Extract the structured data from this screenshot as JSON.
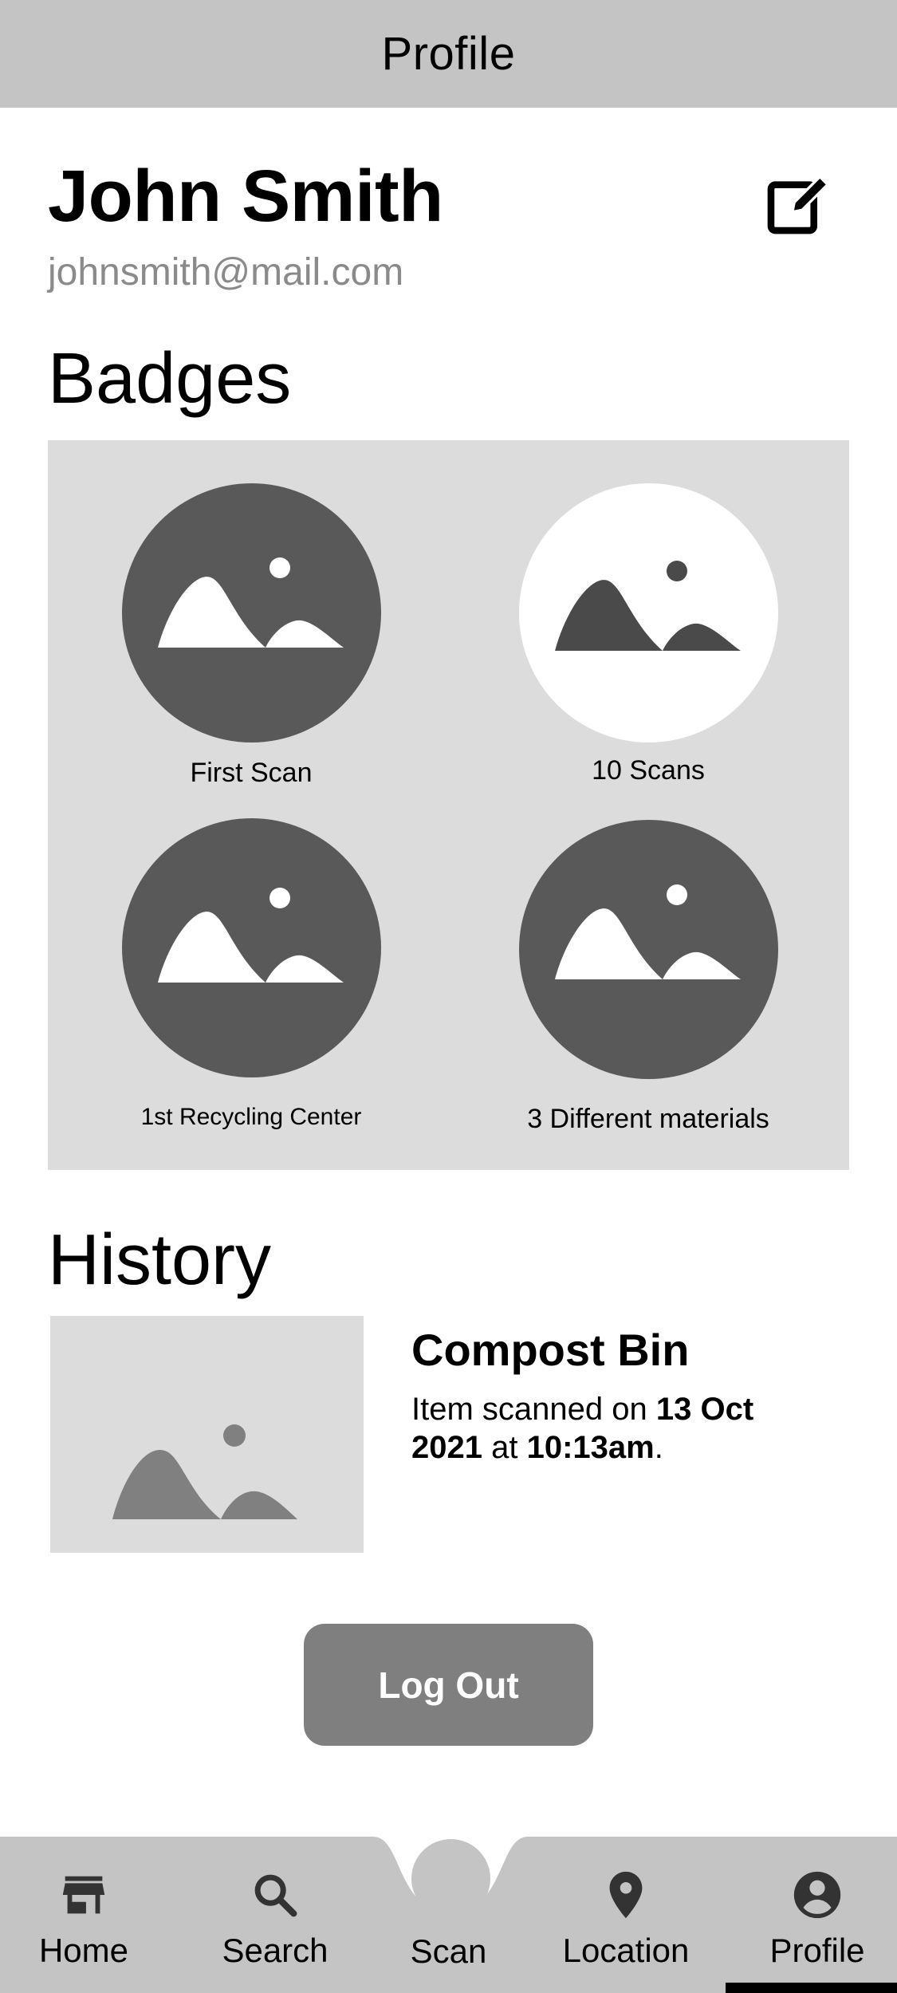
{
  "header": {
    "title": "Profile"
  },
  "user": {
    "name": "John Smith",
    "email": "johnsmith@mail.com",
    "edit_icon": "edit-icon"
  },
  "badges": {
    "title": "Badges",
    "items": [
      {
        "label": "First Scan",
        "earned": true
      },
      {
        "label": "10 Scans",
        "earned": false
      },
      {
        "label": "1st Recycling Center",
        "earned": true
      },
      {
        "label": "3 Different materials",
        "earned": true
      }
    ]
  },
  "history": {
    "title": "History",
    "items": [
      {
        "title": "Compost Bin",
        "desc_prefix": "Item scanned on ",
        "date": "13 Oct 2021",
        "desc_mid": " at ",
        "time": "10:13am",
        "desc_suffix": "."
      }
    ]
  },
  "actions": {
    "logout_label": "Log Out"
  },
  "nav": {
    "items": [
      {
        "label": "Home",
        "icon": "store-icon"
      },
      {
        "label": "Search",
        "icon": "search-icon"
      },
      {
        "label": "Scan",
        "icon": "scan-button"
      },
      {
        "label": "Location",
        "icon": "location-pin-icon"
      },
      {
        "label": "Profile",
        "icon": "account-circle-icon"
      }
    ],
    "active": "Profile"
  },
  "colors": {
    "header_bg": "#c4c4c4",
    "badge_box": "#dcdcdc",
    "badge_earned": "#595959",
    "logout_bg": "#7f7f7f"
  }
}
